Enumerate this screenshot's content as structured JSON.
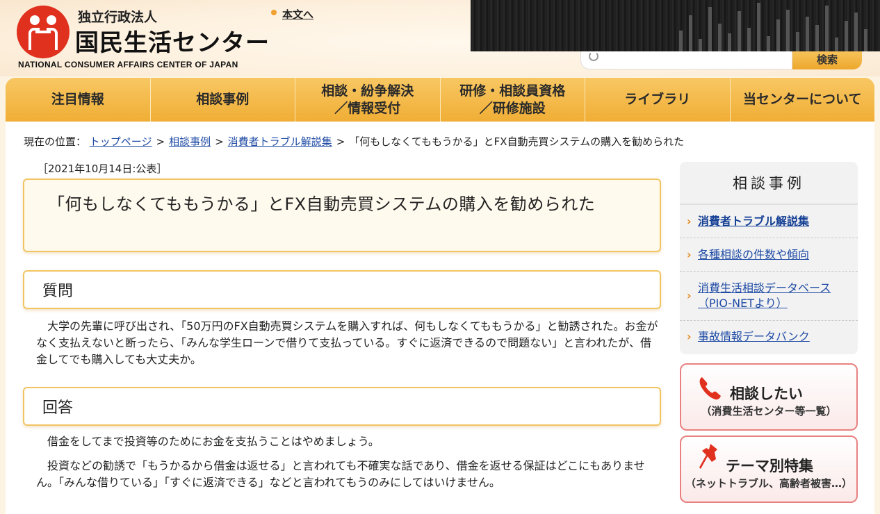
{
  "header": {
    "org_type": "独立行政法人",
    "org_name": "国民生活センター",
    "org_name_en": "NATIONAL CONSUMER AFFAIRS CENTER OF JAPAN",
    "skip_link": "本文へ",
    "search_placeholder": "",
    "search_button": "検索"
  },
  "nav": {
    "items": [
      {
        "label": "注目情報"
      },
      {
        "label": "相談事例"
      },
      {
        "label": "相談・紛争解決\n／情報受付"
      },
      {
        "label": "研修・相談員資格\n／研修施設"
      },
      {
        "label": "ライブラリ"
      },
      {
        "label": "当センターについて"
      }
    ]
  },
  "breadcrumb": {
    "prefix": "現在の位置：",
    "items": [
      "トップページ",
      "相談事例",
      "消費者トラブル解説集"
    ],
    "current": "「何もしなくてももうかる」とFX自動売買システムの購入を勧められた",
    "separator": ">"
  },
  "article": {
    "date": "［2021年10月14日:公表］",
    "title": "「何もしなくてももうかる」とFX自動売買システムの購入を勧められた",
    "question_heading": "質問",
    "question_text": "大学の先輩に呼び出され、「50万円のFX自動売買システムを購入すれば、何もしなくてももうかる」と勧誘された。お金がなく支払えないと断ったら、「みんな学生ローンで借りて支払っている。すぐに返済できるので問題ない」と言われたが、借金してでも購入しても大丈夫か。",
    "answer_heading": "回答",
    "answer_p1": "借金をしてまで投資等のためにお金を支払うことはやめましょう。",
    "answer_p2": "投資などの勧誘で「もうかるから借金は返せる」と言われても不確実な話であり、借金を返せる保証はどこにもありません。「みんな借りている」「すぐに返済できる」などと言われてもうのみにしてはいけません。"
  },
  "sidebar": {
    "title": "相談事例",
    "items": [
      {
        "label": "消費者トラブル解説集"
      },
      {
        "label": "各種相談の件数や傾向"
      },
      {
        "label": "消費生活相談データベース\n（PIO-NETより）"
      },
      {
        "label": "事故情報データバンク"
      }
    ],
    "consult_main": "相談したい",
    "consult_sub": "（消費生活センター等一覧）",
    "theme_main": "テーマ別特集",
    "theme_sub": "（ネットトラブル、高齢者被害…）"
  },
  "colors": {
    "nav_bg": "#f0ae35",
    "accent_border": "#f2c564",
    "link": "#1f4ba5",
    "logo_red": "#e0301e",
    "side_btn_border": "#e98080"
  },
  "icons": {
    "logo": "people-holding-hands-icon",
    "search": "search-icon",
    "phone": "phone-icon",
    "pin": "pushpin-icon"
  }
}
